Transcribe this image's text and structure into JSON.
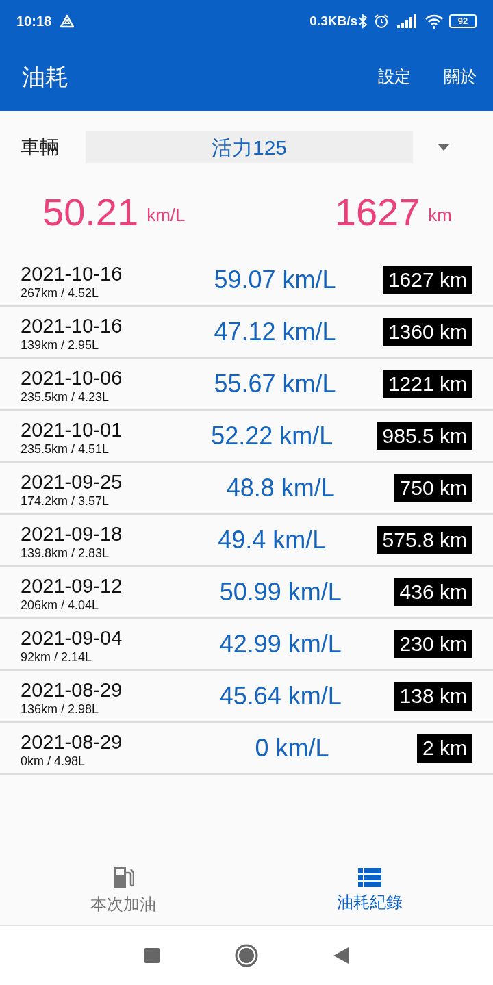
{
  "status_bar": {
    "time": "10:18",
    "speed": "0.3KB/s",
    "battery": "92"
  },
  "app_bar": {
    "title": "油耗",
    "actions": [
      "設定",
      "關於"
    ]
  },
  "vehicle": {
    "label": "車輛",
    "value": "活力125"
  },
  "summary": {
    "efficiency": "50.21",
    "efficiency_unit": "km/L",
    "distance": "1627",
    "distance_unit": "km"
  },
  "records": [
    {
      "date": "2021-10-16",
      "detail": "267km / 4.52L",
      "efficiency": "59.07 km/L",
      "odometer": "1627 km"
    },
    {
      "date": "2021-10-16",
      "detail": "139km / 2.95L",
      "efficiency": "47.12 km/L",
      "odometer": "1360 km"
    },
    {
      "date": "2021-10-06",
      "detail": "235.5km / 4.23L",
      "efficiency": "55.67 km/L",
      "odometer": "1221 km"
    },
    {
      "date": "2021-10-01",
      "detail": "235.5km / 4.51L",
      "efficiency": "52.22 km/L",
      "odometer": "985.5 km"
    },
    {
      "date": "2021-09-25",
      "detail": "174.2km / 3.57L",
      "efficiency": "48.8 km/L",
      "odometer": "750 km"
    },
    {
      "date": "2021-09-18",
      "detail": "139.8km / 2.83L",
      "efficiency": "49.4 km/L",
      "odometer": "575.8 km"
    },
    {
      "date": "2021-09-12",
      "detail": "206km / 4.04L",
      "efficiency": "50.99 km/L",
      "odometer": "436 km"
    },
    {
      "date": "2021-09-04",
      "detail": "92km / 2.14L",
      "efficiency": "42.99 km/L",
      "odometer": "230 km"
    },
    {
      "date": "2021-08-29",
      "detail": "136km / 2.98L",
      "efficiency": "45.64 km/L",
      "odometer": "138 km"
    },
    {
      "date": "2021-08-29",
      "detail": "0km / 4.98L",
      "efficiency": "0 km/L",
      "odometer": "2 km"
    }
  ],
  "bottom_nav": [
    {
      "kind": "fuel",
      "label": "本次加油",
      "selected": false
    },
    {
      "kind": "list",
      "label": "油耗紀錄",
      "selected": true
    }
  ]
}
